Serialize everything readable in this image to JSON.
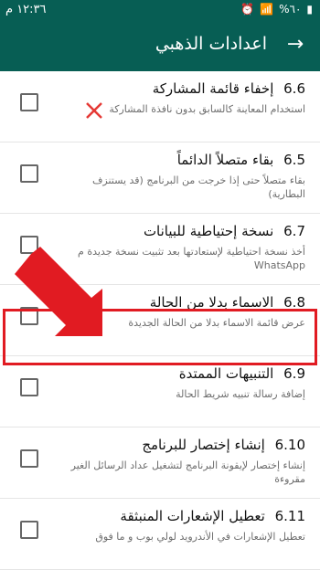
{
  "status_bar": {
    "time": "١٢:٣٦ م",
    "battery": "%٦٠",
    "icons": [
      "alarm-icon",
      "wifi-icon",
      "signal-icon",
      "battery-icon"
    ]
  },
  "app_bar": {
    "title": "اعدادات الذهبي",
    "back_icon": "arrow-right-icon"
  },
  "rows": [
    {
      "number": "6.6",
      "title": "إخفاء قائمة المشاركة",
      "description": "استخدام المعاينة كالسابق بدون نافذة المشاركة"
    },
    {
      "number": "6.5",
      "title": "بقاء متصلاً الدائماً",
      "description": "بقاء متصلاً حتى إذا خرجت من البرنامج (قد يستنزف البطارية)"
    },
    {
      "number": "6.7",
      "title": "نسخة إحتياطية للبيانات",
      "description": "أخذ نسخة احتياطية لإستعادتها بعد تثبيت نسخة جديدة م WhatsApp"
    },
    {
      "number": "6.8",
      "title": "الاسماء بدلا من الحالة",
      "description": "عرض قائمة الاسماء بدلا من الحالة الجديدة"
    },
    {
      "number": "6.9",
      "title": "التنبيهات الممتدة",
      "description": "إضافة رسالة تنبيه شريط الحالة"
    },
    {
      "number": "6.10",
      "title": "إنشاء إختصار للبرنامج",
      "description": "إنشاء إختصار لإيقونة البرنامج لتشغيل عداد الرسائل الغير مقروءة"
    },
    {
      "number": "6.11",
      "title": "تعطيل الإشعارات المنبثقة",
      "description": "تعطيل الإشعارات في الأندرويد لولي بوب و ما فوق"
    }
  ],
  "annotations": {
    "highlight_color": "#e11b22",
    "arrow_color": "#e11b22",
    "x_mark_color": "#e53935"
  }
}
